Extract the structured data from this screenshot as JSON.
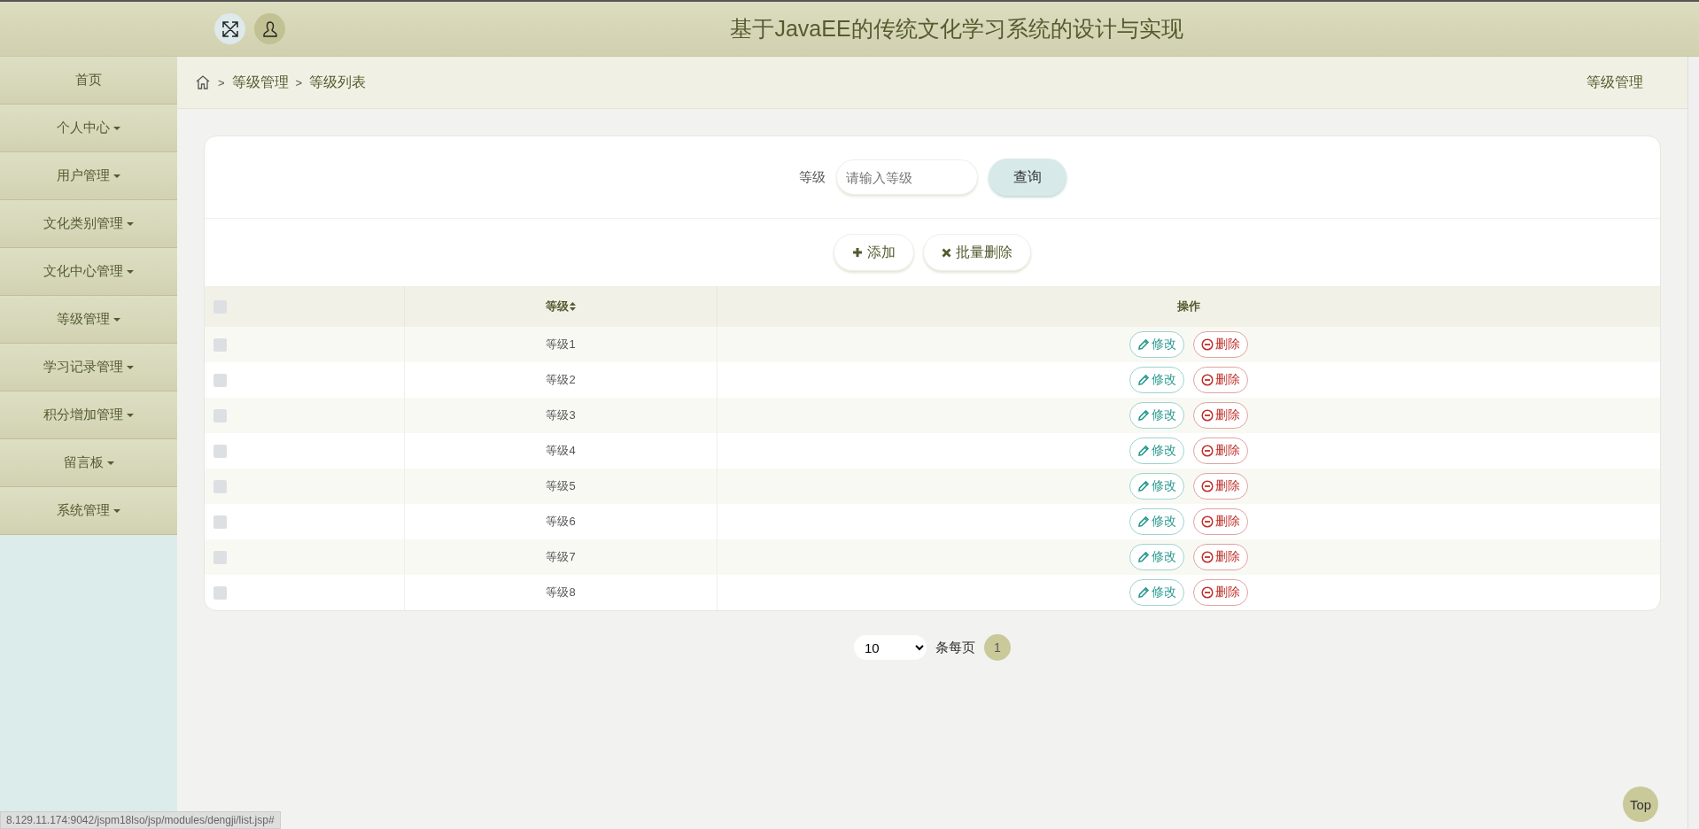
{
  "header": {
    "title": "基于JavaEE的传统文化学习系统的设计与实现"
  },
  "sidebar": {
    "items": [
      {
        "label": "首页",
        "kind": "link"
      },
      {
        "label": "个人中心",
        "kind": "menu"
      },
      {
        "label": "用户管理",
        "kind": "menu"
      },
      {
        "label": "文化类别管理",
        "kind": "menu"
      },
      {
        "label": "文化中心管理",
        "kind": "menu"
      },
      {
        "label": "等级管理",
        "kind": "menu"
      },
      {
        "label": "学习记录管理",
        "kind": "menu"
      },
      {
        "label": "积分增加管理",
        "kind": "menu"
      },
      {
        "label": "留言板",
        "kind": "menu"
      },
      {
        "label": "系统管理",
        "kind": "menu"
      }
    ]
  },
  "breadcrumb": {
    "separator": ">",
    "items": [
      "等级管理",
      "等级列表"
    ],
    "page_title": "等级管理"
  },
  "search": {
    "label": "等级",
    "placeholder": "请输入等级",
    "button": "查询"
  },
  "actions": {
    "add": "添加",
    "batch_delete": "批量删除"
  },
  "table": {
    "header_checked": false,
    "columns": [
      {
        "label": "等级",
        "sortable": true
      },
      {
        "label": "操作",
        "sortable": false
      }
    ],
    "rows": [
      {
        "checked": false,
        "level": "等级1",
        "edit": "修改",
        "delete": "删除"
      },
      {
        "checked": false,
        "level": "等级2",
        "edit": "修改",
        "delete": "删除"
      },
      {
        "checked": false,
        "level": "等级3",
        "edit": "修改",
        "delete": "删除"
      },
      {
        "checked": false,
        "level": "等级4",
        "edit": "修改",
        "delete": "删除"
      },
      {
        "checked": false,
        "level": "等级5",
        "edit": "修改",
        "delete": "删除"
      },
      {
        "checked": false,
        "level": "等级6",
        "edit": "修改",
        "delete": "删除"
      },
      {
        "checked": false,
        "level": "等级7",
        "edit": "修改",
        "delete": "删除"
      },
      {
        "checked": false,
        "level": "等级8",
        "edit": "修改",
        "delete": "删除"
      }
    ]
  },
  "pagination": {
    "page_size": "10",
    "per_page_label": "条每页",
    "pages": [
      {
        "label": "1",
        "selected": true
      }
    ]
  },
  "top_button": "Top",
  "status_url": "8.129.11.174:9042/jspm18lso/jsp/modules/dengji/list.jsp#"
}
